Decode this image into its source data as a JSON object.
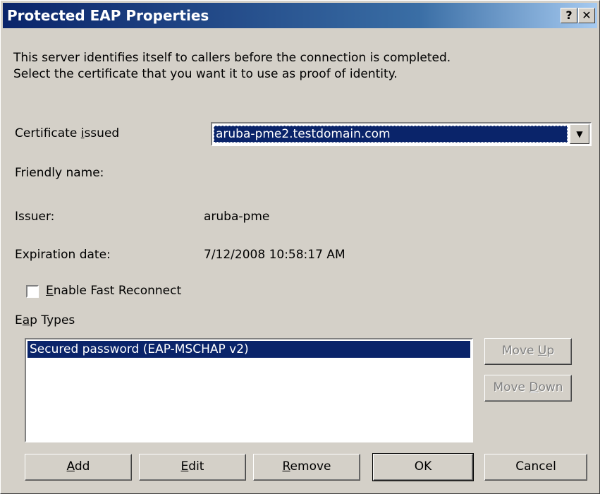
{
  "window": {
    "title": "Protected EAP Properties",
    "help_button": "?",
    "close_button": "✕"
  },
  "intro": {
    "line1": "This server identifies itself to callers before the connection is completed.",
    "line2": "Select the certificate that you want it to use as proof of identity."
  },
  "certificate": {
    "label_pre": "Certificate ",
    "label_key": "i",
    "label_post": "ssued",
    "selected": "aruba-pme2.testdomain.com",
    "dropdown_icon": "chevron-down-icon"
  },
  "friendly_name": {
    "label": "Friendly name:",
    "value": ""
  },
  "issuer": {
    "label": "Issuer:",
    "value": "aruba-pme"
  },
  "expiration": {
    "label": "Expiration date:",
    "value": "7/12/2008 10:58:17 AM"
  },
  "fast_reconnect": {
    "label_key": "E",
    "label_post": "nable Fast Reconnect",
    "checked": false
  },
  "eap_types": {
    "label_pre": "E",
    "label_key": "a",
    "label_post": "p Types",
    "items": [
      "Secured password (EAP-MSCHAP v2)"
    ]
  },
  "buttons": {
    "move_up": {
      "pre": "Move ",
      "key": "U",
      "post": "p"
    },
    "move_down": {
      "pre": "Move ",
      "key": "D",
      "post": "own"
    },
    "add": {
      "pre": "",
      "key": "A",
      "post": "dd"
    },
    "edit": {
      "pre": "",
      "key": "E",
      "post": "dit"
    },
    "remove": {
      "pre": "",
      "key": "R",
      "post": "emove"
    },
    "ok": "OK",
    "cancel": "Cancel"
  }
}
